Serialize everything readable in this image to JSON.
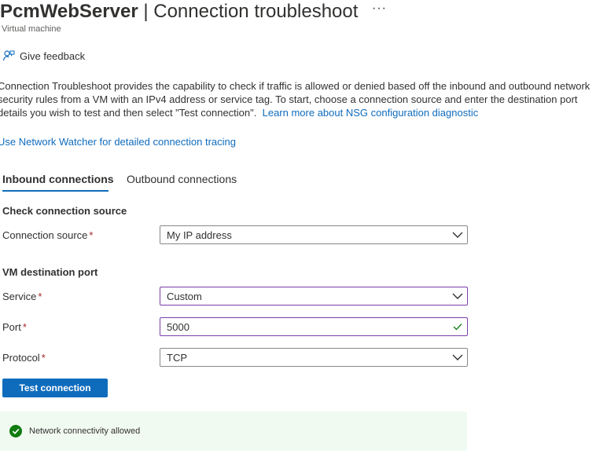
{
  "header": {
    "resource_name": "PcmWebServer",
    "separator": " | ",
    "page_title": "Connection troubleshoot",
    "more_label": "···",
    "subtitle": "Virtual machine"
  },
  "toolbar": {
    "feedback_label": "Give feedback",
    "feedback_icon": "feedback-icon"
  },
  "description": {
    "text": "Connection Troubleshoot provides the capability to check if traffic is allowed or denied based off the inbound and outbound network security rules from a VM with an IPv4 address or service tag. To start, choose a connection source and enter the destination port details you wish to test and then select \"Test connection\".",
    "learn_more_link": "Learn more about NSG configuration diagnostic",
    "network_watcher_link": "Use Network Watcher for detailed connection tracing"
  },
  "tabs": [
    {
      "label": "Inbound connections",
      "selected": true
    },
    {
      "label": "Outbound connections",
      "selected": false
    }
  ],
  "source_section": {
    "heading": "Check connection source",
    "connection_source": {
      "label": "Connection source",
      "required_mark": "*",
      "value": "My IP address"
    }
  },
  "destination_section": {
    "heading": "VM destination port",
    "service": {
      "label": "Service",
      "required_mark": "*",
      "value": "Custom"
    },
    "port": {
      "label": "Port",
      "required_mark": "*",
      "value": "5000",
      "valid": true
    },
    "protocol": {
      "label": "Protocol",
      "required_mark": "*",
      "value": "TCP"
    }
  },
  "actions": {
    "test_button_label": "Test connection"
  },
  "result": {
    "status": "success",
    "text": "Network connectivity allowed"
  },
  "colors": {
    "accent": "#0f6cbd",
    "focus_border": "#7a3eaa",
    "required": "#a4262c",
    "success": "#107c10",
    "success_bg": "#f1faf1"
  }
}
